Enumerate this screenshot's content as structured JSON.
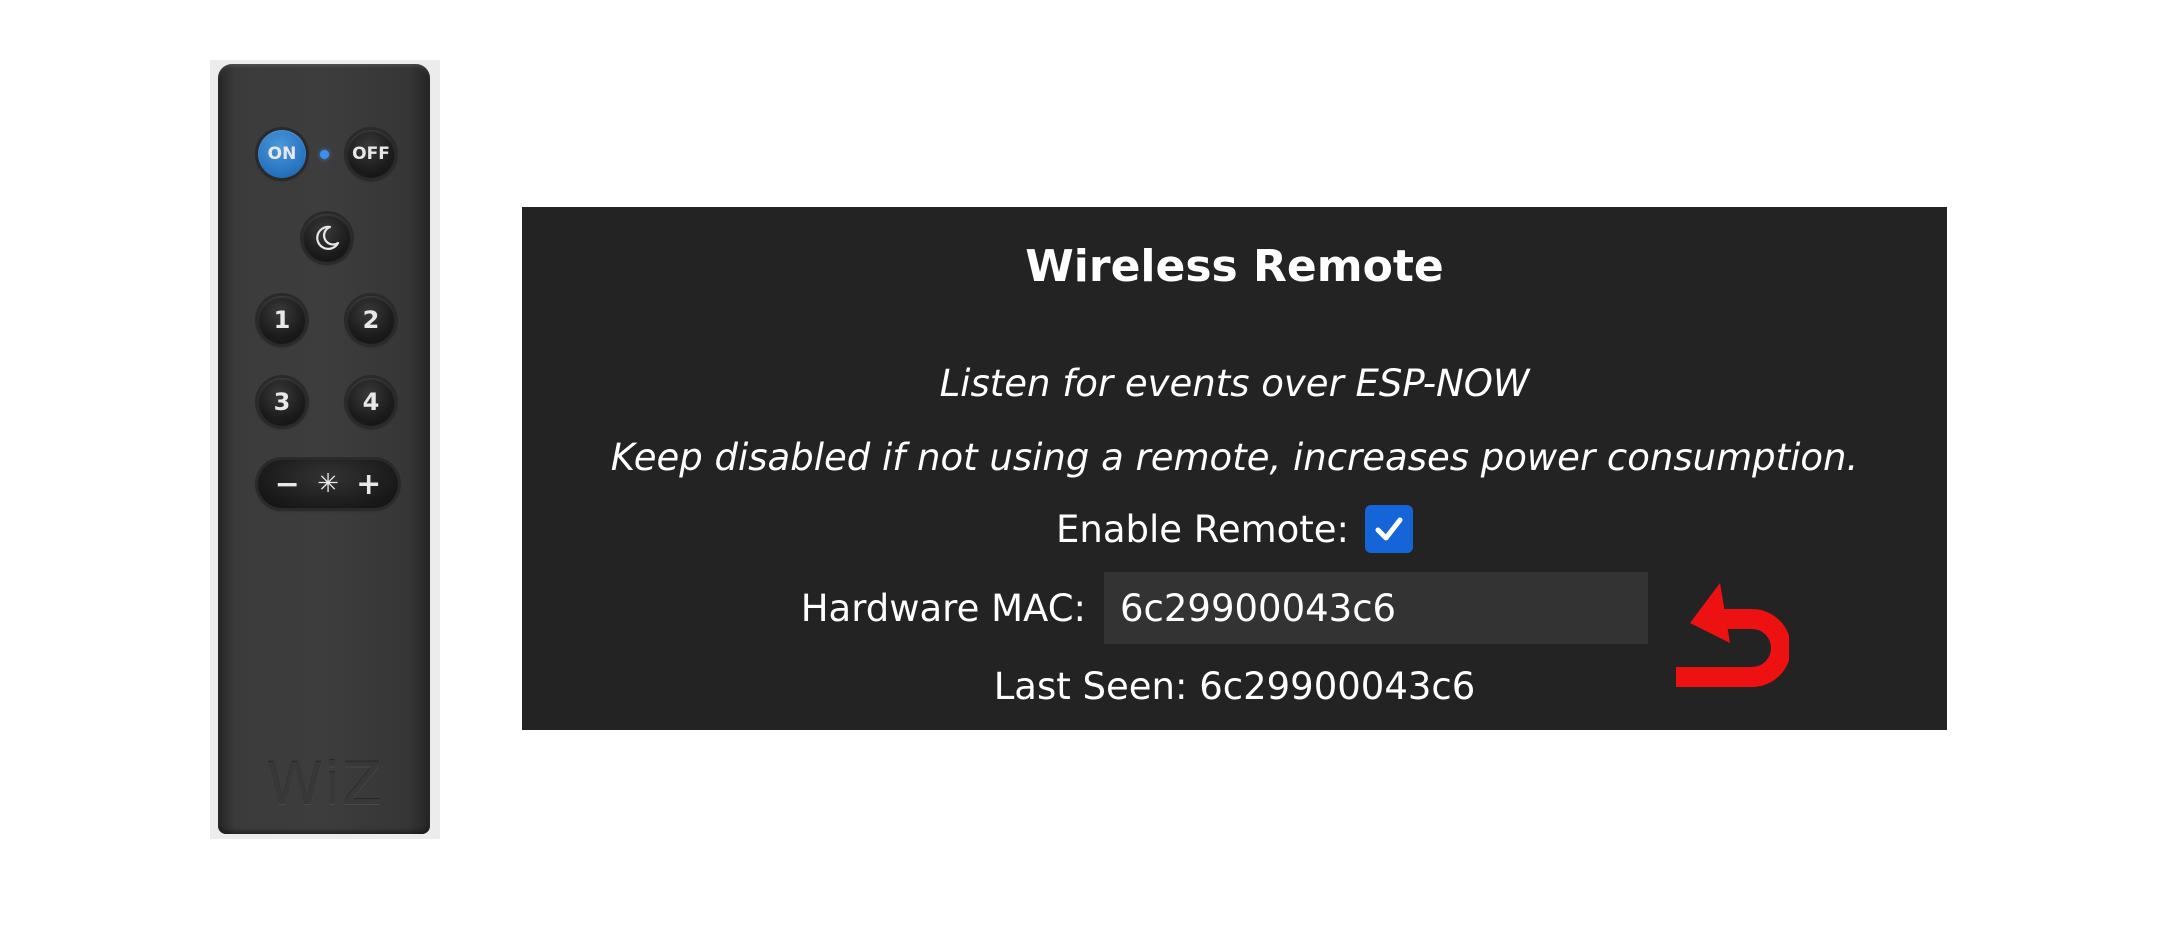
{
  "remote": {
    "on_label": "ON",
    "off_label": "OFF",
    "button_1": "1",
    "button_2": "2",
    "button_3": "3",
    "button_4": "4",
    "minus_label": "−",
    "brightness_label": "✳",
    "plus_label": "+",
    "brand_logo": "WiZ"
  },
  "panel": {
    "title": "Wireless Remote",
    "description_1": "Listen for events over ESP-NOW",
    "description_2": "Keep disabled if not using a remote, increases power consumption.",
    "enable_label": "Enable Remote:",
    "enable_checked": true,
    "mac_label": "Hardware MAC:",
    "mac_value": "6c29900043c6",
    "last_seen_label": "Last Seen:",
    "last_seen_value": "6c29900043c6",
    "revert_icon": "undo-arrow-icon"
  },
  "colors": {
    "panel_bg": "#232323",
    "input_bg": "#333333",
    "checkbox_blue": "#1565d8",
    "revert_red": "#ee1111",
    "remote_on_blue": "#2874c0"
  }
}
